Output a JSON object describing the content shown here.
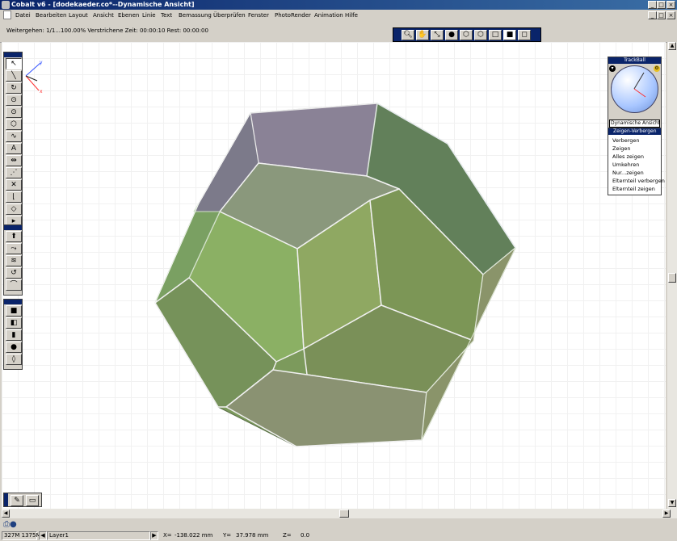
{
  "window": {
    "title": "Cobalt v6 - [dodekaeder.co*--Dynamische Ansicht]",
    "min": "_",
    "max": "□",
    "close": "×",
    "mdi_min": "_",
    "mdi_max": "□",
    "mdi_close": "×"
  },
  "menu": [
    "Datei",
    "Bearbeiten",
    "Layout",
    "Ansicht",
    "Ebenen",
    "Linie",
    "Text",
    "Bemassung",
    "Überprüfen",
    "Fenster",
    "PhotoRender",
    "Animation",
    "Hilfe"
  ],
  "progress": {
    "text": "Weitergehen: 1/1...100.00%  Verstrichene Zeit: 00:00:10  Rest: 00:00:00"
  },
  "view_toolbar": [
    "zoom-icon",
    "pan-hand-icon",
    "walk-icon",
    "render-sphere-icon",
    "wireframe-cube-icon",
    "hidden-line-cube-icon",
    "outline-cube-icon",
    "shaded-cube-icon",
    "transparent-cube-icon"
  ],
  "trackball": {
    "title": "TrackBall",
    "mode": "Dynamische Ansicht"
  },
  "show_hide": {
    "title": "Zeigen-Verbergen",
    "items": [
      "Verbergen",
      "Zeigen",
      "Alles zeigen",
      "Umkehren",
      "Nur...zeigen",
      "Elternteil verbergen",
      "Elternteil zeigen"
    ]
  },
  "axis": {
    "x": "x",
    "y": "y"
  },
  "status": {
    "memory": "327M 1375M",
    "layer": "Layer1",
    "x_label": "X=",
    "x_value": "-138.022 mm",
    "y_label": "Y=",
    "y_value": "37.978 mm",
    "z_label": "Z=",
    "z_value": "0.0"
  },
  "colors": {
    "titlebar": "#0a246a",
    "face_green": "#8aa866",
    "face_purple": "#8c8496"
  }
}
